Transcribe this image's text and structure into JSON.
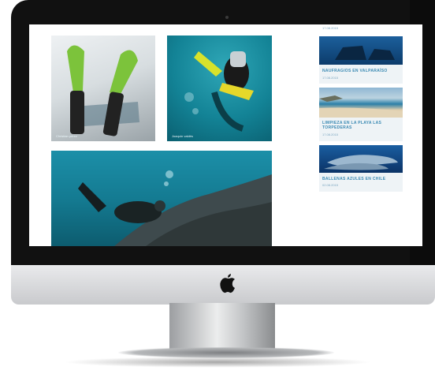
{
  "sidebar": {
    "top_date": "17.08.2015",
    "items": [
      {
        "title": "NAUFRAGIOS EN VALPARAÍSO",
        "date": "17.08.2015"
      },
      {
        "title": "LIMPIEZA EN LA PLAYA LAS TORPEDERAS",
        "date": "17.08.2015"
      },
      {
        "title": "BALLENAS AZULES EN CHILE",
        "date": "02.08.2015"
      }
    ]
  },
  "gallery": {
    "photo1_caption": "Christian pérez",
    "photo2_caption": "Joaquín valdés"
  },
  "colors": {
    "accent": "#3b8ab3",
    "water": "#138396",
    "bezel": "#111111"
  },
  "icons": [
    "apple-logo-icon",
    "camera-icon"
  ]
}
